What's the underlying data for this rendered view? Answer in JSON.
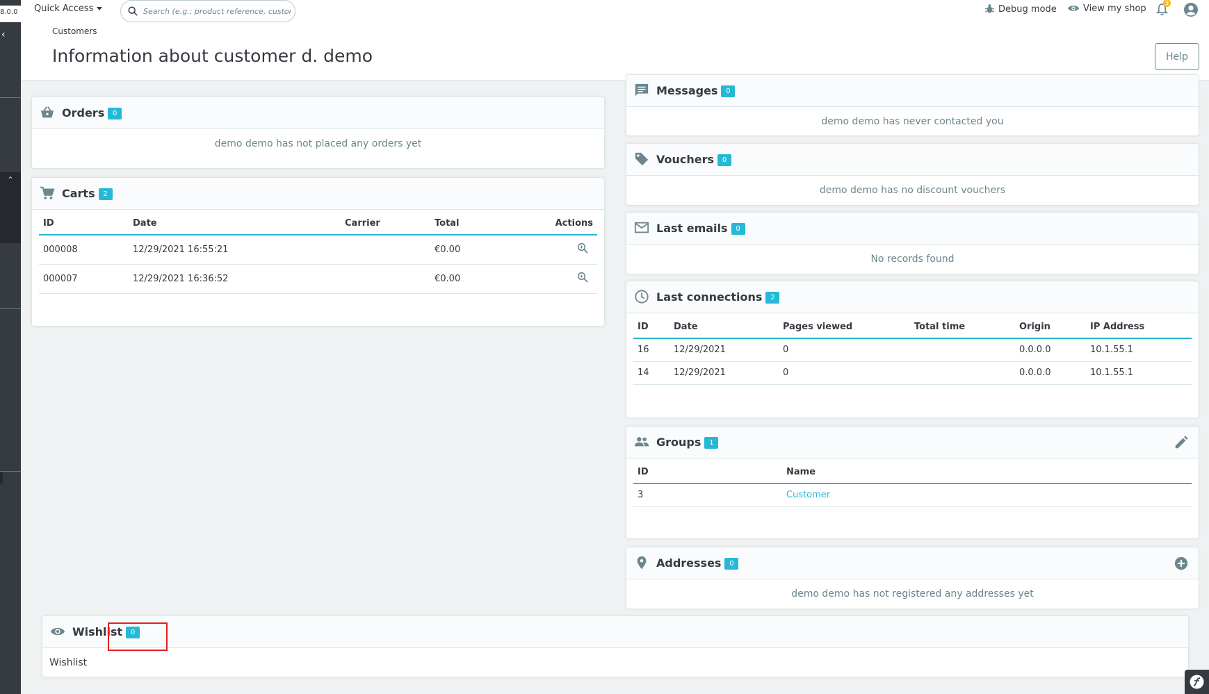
{
  "sidebar": {
    "version": "8.0.0",
    "collapse_glyph": "‹",
    "toggle_glyph": "⌃"
  },
  "header": {
    "quick_access": "Quick Access",
    "search_placeholder": "Search (e.g.: product reference, custon",
    "debug_mode": "Debug mode",
    "view_shop": "View my shop",
    "notifications_count": "3"
  },
  "breadcrumb": "Customers",
  "page_title": "Information about customer d. demo",
  "help_label": "Help",
  "orders": {
    "title": "Orders",
    "count": "0",
    "empty": "demo demo has not placed any orders yet"
  },
  "carts": {
    "title": "Carts",
    "count": "2",
    "columns": {
      "id": "ID",
      "date": "Date",
      "carrier": "Carrier",
      "total": "Total",
      "actions": "Actions"
    },
    "rows": [
      {
        "id": "000008",
        "date": "12/29/2021 16:55:21",
        "carrier": "",
        "total": "€0.00"
      },
      {
        "id": "000007",
        "date": "12/29/2021 16:36:52",
        "carrier": "",
        "total": "€0.00"
      }
    ]
  },
  "messages": {
    "title": "Messages",
    "count": "0",
    "empty": "demo demo has never contacted you"
  },
  "vouchers": {
    "title": "Vouchers",
    "count": "0",
    "empty": "demo demo has no discount vouchers"
  },
  "emails": {
    "title": "Last emails",
    "count": "0",
    "empty": "No records found"
  },
  "connections": {
    "title": "Last connections",
    "count": "2",
    "columns": {
      "id": "ID",
      "date": "Date",
      "pages": "Pages viewed",
      "time": "Total time",
      "origin": "Origin",
      "ip": "IP Address"
    },
    "rows": [
      {
        "id": "16",
        "date": "12/29/2021",
        "pages": "0",
        "time": "",
        "origin": "0.0.0.0",
        "ip": "10.1.55.1"
      },
      {
        "id": "14",
        "date": "12/29/2021",
        "pages": "0",
        "time": "",
        "origin": "0.0.0.0",
        "ip": "10.1.55.1"
      }
    ]
  },
  "groups": {
    "title": "Groups",
    "count": "1",
    "columns": {
      "id": "ID",
      "name": "Name"
    },
    "rows": [
      {
        "id": "3",
        "name": "Customer"
      }
    ]
  },
  "addresses": {
    "title": "Addresses",
    "count": "0",
    "empty": "demo demo has not registered any addresses yet"
  },
  "wishlist": {
    "title": "Wishlist",
    "count": "0",
    "body": "Wishlist"
  },
  "colors": {
    "accent": "#25b9d7",
    "sidebar": "#363a41",
    "highlight_box": "#e0201e"
  }
}
